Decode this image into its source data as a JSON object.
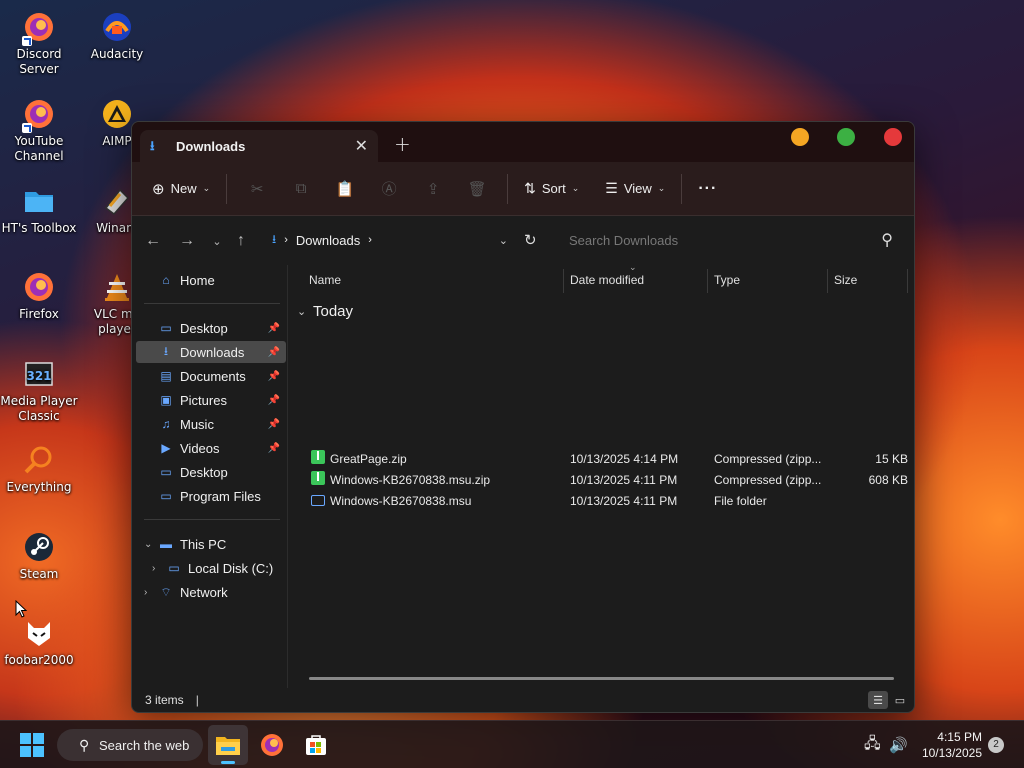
{
  "desktop": {
    "icons": [
      {
        "label": "Discord Server",
        "icon": "firefox-shortcut-icon"
      },
      {
        "label": "Audacity",
        "icon": "audacity-icon"
      },
      {
        "label": "YouTube Channel",
        "icon": "firefox-shortcut-icon"
      },
      {
        "label": "AIMP",
        "icon": "aimp-icon"
      },
      {
        "label": "HT's Toolbox",
        "icon": "folder-icon"
      },
      {
        "label": "Winam",
        "icon": "winamp-icon"
      },
      {
        "label": "Firefox",
        "icon": "firefox-icon"
      },
      {
        "label": "VLC me player",
        "icon": "vlc-icon"
      },
      {
        "label": "Media Player Classic",
        "icon": "mpc-icon"
      },
      {
        "label": "Everything",
        "icon": "everything-icon"
      },
      {
        "label": "Steam",
        "icon": "steam-icon"
      },
      {
        "label": "foobar2000",
        "icon": "foobar-icon"
      }
    ]
  },
  "window": {
    "tab_title": "Downloads",
    "new_tab": "+",
    "controls": {
      "minimize_color": "#f5a623",
      "maximize_color": "#3cb043",
      "close_color": "#e5393b"
    }
  },
  "toolbar": {
    "new_label": "New",
    "sort_label": "Sort",
    "view_label": "View",
    "more_label": "···"
  },
  "address": {
    "path_label": "Downloads",
    "search_placeholder": "Search Downloads"
  },
  "sidebar": {
    "home": "Home",
    "quick": [
      {
        "label": "Desktop",
        "pinned": true
      },
      {
        "label": "Downloads",
        "pinned": true,
        "selected": true
      },
      {
        "label": "Documents",
        "pinned": true
      },
      {
        "label": "Pictures",
        "pinned": true
      },
      {
        "label": "Music",
        "pinned": true
      },
      {
        "label": "Videos",
        "pinned": true
      },
      {
        "label": "Desktop",
        "pinned": false
      },
      {
        "label": "Program Files",
        "pinned": false
      }
    ],
    "this_pc": "This PC",
    "local_disk": "Local Disk (C:)",
    "network": "Network"
  },
  "columns": {
    "name": "Name",
    "date": "Date modified",
    "type": "Type",
    "size": "Size"
  },
  "group_label": "Today",
  "files": [
    {
      "name": "GreatPage.zip",
      "date": "10/13/2025 4:14 PM",
      "type": "Compressed (zipp...",
      "size": "15 KB",
      "kind": "zip"
    },
    {
      "name": "Windows-KB2670838.msu.zip",
      "date": "10/13/2025 4:11 PM",
      "type": "Compressed (zipp...",
      "size": "608 KB",
      "kind": "zip"
    },
    {
      "name": "Windows-KB2670838.msu",
      "date": "10/13/2025 4:11 PM",
      "type": "File folder",
      "size": "",
      "kind": "folder"
    }
  ],
  "status": {
    "items": "3 items"
  },
  "taskbar": {
    "search_label": "Search the web",
    "time": "4:15 PM",
    "date": "10/13/2025",
    "notifications": "2"
  }
}
